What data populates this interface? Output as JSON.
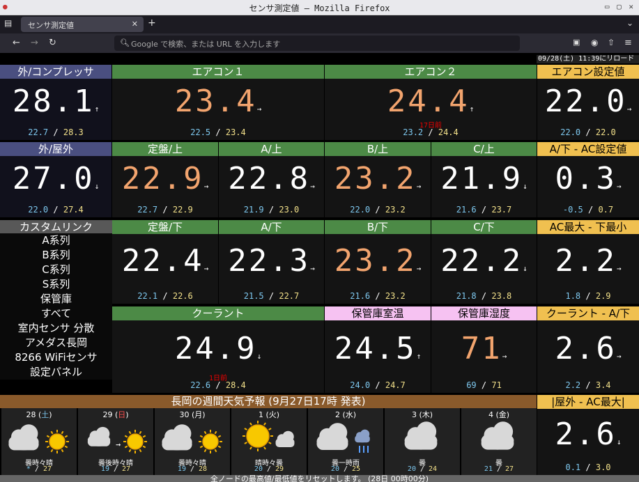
{
  "window": {
    "title": "センサ測定値 — Mozilla Firefox"
  },
  "tab": {
    "title": "センサ測定値"
  },
  "nav": {
    "url_placeholder": "Google で検索、または URL を入力します"
  },
  "reload_note": "09/28(土) 11:39にリロード",
  "sensors": [
    {
      "id": "ext-comp",
      "label": "外/コンプレッサ",
      "value": "28.1",
      "arrow": "↑",
      "min": "22.7",
      "max": "28.3"
    },
    {
      "id": "ac1",
      "label": "エアコン１",
      "value": "23.4",
      "arrow": "→",
      "min": "22.5",
      "max": "23.4"
    },
    {
      "id": "ac2",
      "label": "エアコン２",
      "value": "24.4",
      "arrow": "↑",
      "ago": "17日前",
      "min": "23.2",
      "max": "24.4"
    },
    {
      "id": "ac-set",
      "label": "エアコン設定値",
      "value": "22.0",
      "arrow": "→",
      "min": "22.0",
      "max": "22.0"
    },
    {
      "id": "ext-out",
      "label": "外/屋外",
      "value": "27.0",
      "arrow": "↓",
      "min": "22.0",
      "max": "27.4"
    },
    {
      "id": "tei-up",
      "label": "定盤/上",
      "value": "22.9",
      "arrow": "→",
      "min": "22.7",
      "max": "22.9"
    },
    {
      "id": "a-up",
      "label": "A/上",
      "value": "22.8",
      "arrow": "→",
      "min": "21.9",
      "max": "23.0"
    },
    {
      "id": "b-up",
      "label": "B/上",
      "value": "23.2",
      "arrow": "→",
      "min": "22.0",
      "max": "23.2"
    },
    {
      "id": "c-up",
      "label": "C/上",
      "value": "21.9",
      "arrow": "↓",
      "min": "21.6",
      "max": "23.7"
    },
    {
      "id": "a-ac",
      "label": "A/下 - AC設定値",
      "value": "0.3",
      "arrow": "→",
      "min": "-0.5",
      "max": "0.7"
    },
    {
      "id": "tei-down",
      "label": "定盤/下",
      "value": "22.4",
      "arrow": "→",
      "min": "22.1",
      "max": "22.6"
    },
    {
      "id": "a-down",
      "label": "A/下",
      "value": "22.3",
      "arrow": "→",
      "min": "21.5",
      "max": "22.7"
    },
    {
      "id": "b-down",
      "label": "B/下",
      "value": "23.2",
      "arrow": "→",
      "min": "21.6",
      "max": "23.2"
    },
    {
      "id": "c-down",
      "label": "C/下",
      "value": "22.2",
      "arrow": "↓",
      "min": "21.8",
      "max": "23.8"
    },
    {
      "id": "acmax",
      "label": "AC最大 - 下最小",
      "value": "2.2",
      "arrow": "→",
      "min": "1.8",
      "max": "2.9"
    },
    {
      "id": "coolant",
      "label": "クーラント",
      "value": "24.9",
      "arrow": "↓",
      "ago": "1日前",
      "min": "22.6",
      "max": "28.4"
    },
    {
      "id": "store-temp",
      "label": "保管庫室温",
      "value": "24.5",
      "arrow": "↑",
      "min": "24.0",
      "max": "24.7"
    },
    {
      "id": "store-hum",
      "label": "保管庫湿度",
      "value": "71",
      "arrow": "→",
      "min": "69",
      "max": "71"
    },
    {
      "id": "coolant-a",
      "label": "クーラント - A/下",
      "value": "2.6",
      "arrow": "→",
      "min": "2.2",
      "max": "3.4"
    },
    {
      "id": "out-ac",
      "label": "|屋外 - AC最大|",
      "value": "2.6",
      "arrow": "↓",
      "min": "0.1",
      "max": "3.0"
    }
  ],
  "links": {
    "title": "カスタムリンク",
    "items": [
      "A系列",
      "B系列",
      "C系列",
      "S系列",
      "保管庫",
      "すべて",
      "室内センサ 分散",
      "アメダス長岡",
      "8266 WiFiセンサ",
      "設定パネル"
    ]
  },
  "weather": {
    "title": "長岡の週間天気予報 (9月27日17時 発表)",
    "days": [
      {
        "date": "28",
        "wd": "土",
        "desc": "曇時々晴",
        "min": "*",
        "max": "27",
        "icon": "cloud-sun"
      },
      {
        "date": "29",
        "wd": "日",
        "desc": "曇後時々晴",
        "min": "19",
        "max": "27",
        "icon": "cloud-then-sun"
      },
      {
        "date": "30",
        "wd": "月",
        "desc": "曇時々晴",
        "min": "19",
        "max": "28",
        "icon": "cloud-sun"
      },
      {
        "date": "1",
        "wd": "火",
        "desc": "晴時々曇",
        "min": "20",
        "max": "29",
        "icon": "sun-cloud"
      },
      {
        "date": "2",
        "wd": "水",
        "desc": "曇一時雨",
        "min": "20",
        "max": "25",
        "icon": "cloud-rain"
      },
      {
        "date": "3",
        "wd": "木",
        "desc": "曇",
        "min": "20",
        "max": "24",
        "icon": "cloud"
      },
      {
        "date": "4",
        "wd": "金",
        "desc": "曇",
        "min": "21",
        "max": "27",
        "icon": "cloud"
      }
    ]
  },
  "footer": "全ノードの最高値/最低値をリセットします。 (28日 00時00分)"
}
